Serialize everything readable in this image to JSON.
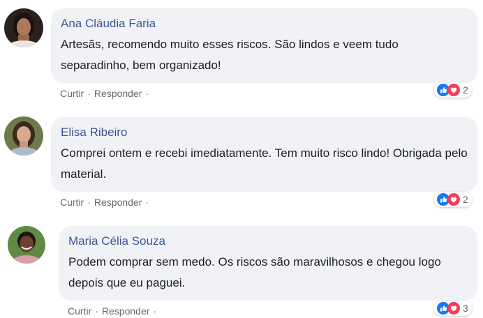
{
  "comments": [
    {
      "author": "Ana Cláudia Faria",
      "text": "Artesãs, recomendo muito esses riscos. São lindos e veem tudo separadinho, bem organizado!",
      "actions": {
        "like": "Curtir",
        "reply": "Responder",
        "sep": "·"
      },
      "reactions": {
        "icons": [
          "like-icon",
          "love-icon"
        ],
        "count": "2"
      }
    },
    {
      "author": "Elisa Ribeiro",
      "text": "Comprei ontem e recebi imediatamente. Tem muito risco lindo! Obrigada pelo material.",
      "actions": {
        "like": "Curtir",
        "reply": "Responder",
        "sep": "·"
      },
      "reactions": {
        "icons": [
          "like-icon",
          "love-icon"
        ],
        "count": "2"
      }
    },
    {
      "author": "Maria Célia Souza",
      "text": "Podem comprar sem medo. Os riscos são maravilhosos e chegou logo depois que eu paguei.",
      "actions": {
        "like": "Curtir",
        "reply": "Responder",
        "sep": "·"
      },
      "reactions": {
        "icons": [
          "like-icon",
          "love-icon"
        ],
        "count": "3"
      }
    }
  ],
  "colors": {
    "author": "#385898",
    "bubble": "#f0f2f5",
    "like": "#1877f2",
    "love": "#f33e58",
    "meta": "#65676b"
  }
}
